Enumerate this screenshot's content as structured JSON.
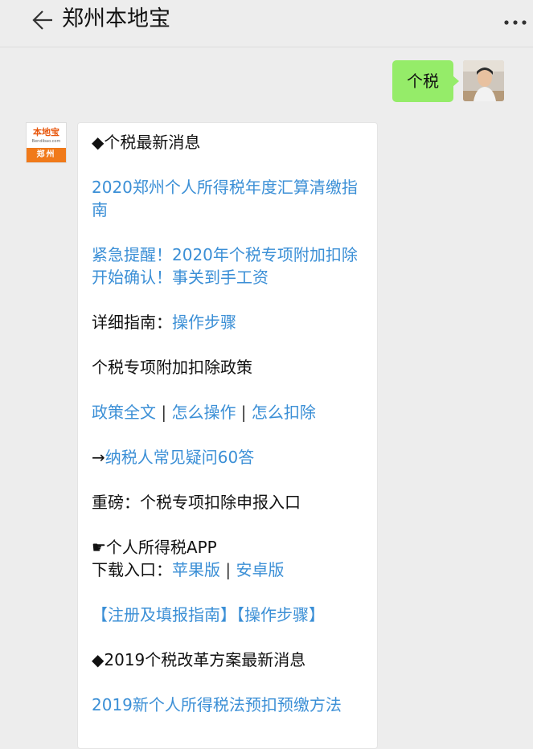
{
  "header": {
    "title": "郑州本地宝"
  },
  "outgoing": {
    "text": "个税"
  },
  "bot": {
    "logo_line1": "本地宝",
    "logo_url": "Bendibao.com",
    "logo_city": "郑州"
  },
  "messages": {
    "section1": "◆个税最新消息",
    "link1_line1": "2020郑州个人所得税年度汇算清缴指",
    "link1_line2": "南",
    "link2_line1": "紧急提醒！2020年个税专项附加扣除",
    "link2_line2": "开始确认！事关到手工资",
    "guide_prefix": "详细指南：",
    "guide_link": "操作步骤",
    "policy_title": "个税专项附加扣除政策",
    "policy_link1": "政策全文",
    "policy_sep1": " | ",
    "policy_link2": "怎么操作",
    "policy_sep2": " | ",
    "policy_link3": "怎么扣除",
    "faq_prefix": "→",
    "faq_link": "纳税人常见疑问60答",
    "heavy": "重磅：个税专项扣除申报入口",
    "app_title": "☛个人所得税APP",
    "download_prefix": "下载入口：",
    "apple_link": "苹果版",
    "download_sep": " | ",
    "android_link": "安卓版",
    "register_link": "【注册及填报指南】",
    "steps_link": "【操作步骤】",
    "section2": "◆2019个税改革方案最新消息",
    "link_2019": "2019新个人所得税法预扣预缴方法"
  }
}
